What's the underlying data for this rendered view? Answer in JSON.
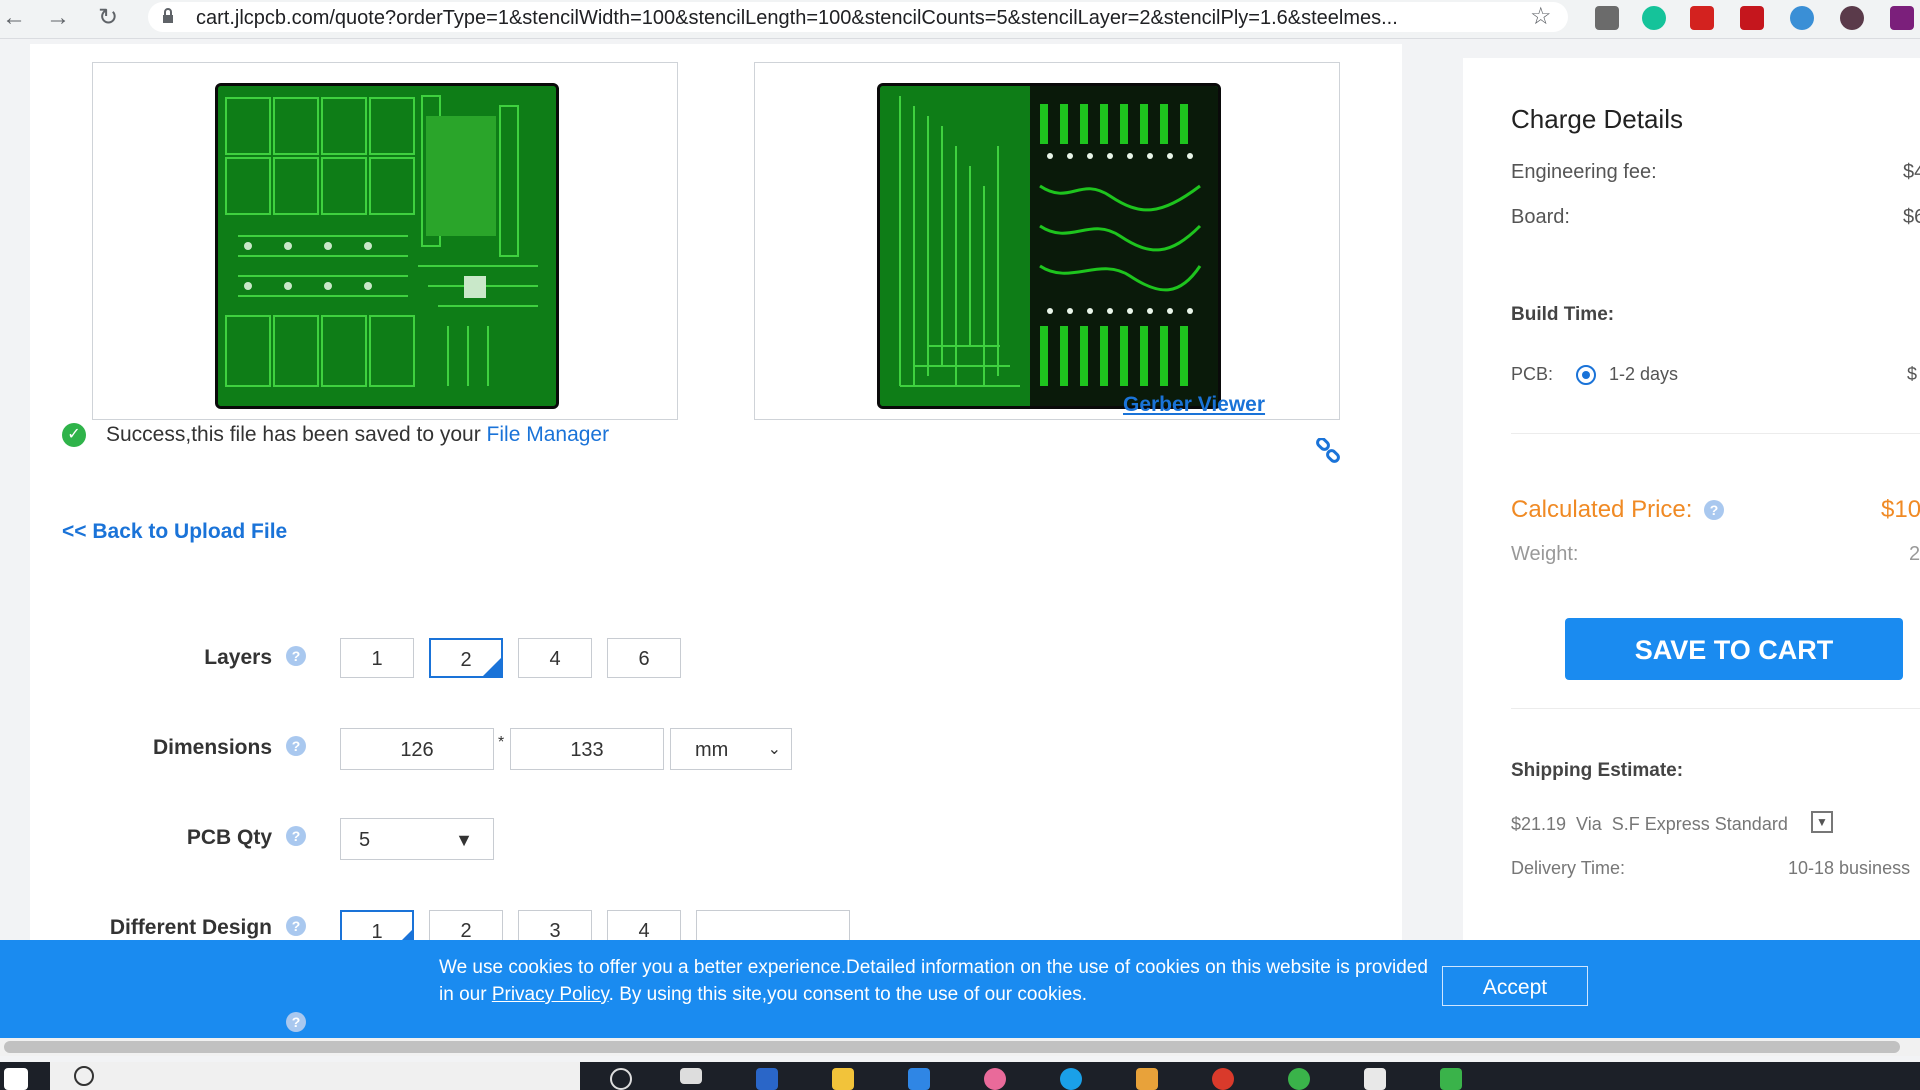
{
  "browser": {
    "url": "cart.jlcpcb.com/quote?orderType=1&stencilWidth=100&stencilLength=100&stencilCounts=5&stencilLayer=2&stencilPly=1.6&steelmes..."
  },
  "viewer": {
    "gerber_link": "Gerber Viewer"
  },
  "status": {
    "success_text": "Success,this file has been saved to your ",
    "file_manager_link": "File Manager",
    "back_link": "<< Back to Upload File"
  },
  "form": {
    "layers": {
      "label": "Layers",
      "options": [
        "1",
        "2",
        "4",
        "6"
      ],
      "selected": "2"
    },
    "dimensions": {
      "label": "Dimensions",
      "width": "126",
      "separator": "*",
      "length": "133",
      "unit": "mm"
    },
    "qty": {
      "label": "PCB Qty",
      "value": "5"
    },
    "design": {
      "label": "Different Design",
      "options": [
        "1",
        "2",
        "3",
        "4"
      ],
      "selected": "1"
    }
  },
  "charges": {
    "title": "Charge Details",
    "engineering_label": "Engineering fee:",
    "engineering_value": "$4",
    "board_label": "Board:",
    "board_value": "$6",
    "build_time_heading": "Build Time:",
    "pcb_label": "PCB:",
    "pcb_option": "1-2 days",
    "pcb_option_value": "$",
    "calc_label": "Calculated Price:",
    "calc_value": "$10",
    "weight_label": "Weight:",
    "weight_value": "2",
    "save_button": "SAVE TO CART",
    "shipping_heading": "Shipping Estimate:",
    "shipping_line": "$21.19  Via  S.F Express Standard",
    "delivery_label": "Delivery Time:",
    "delivery_value": "10-18 business"
  },
  "cookie": {
    "text_1": "We use cookies to offer you a better experience.Detailed information on the use of cookies on this website is provided in our ",
    "privacy_link": "Privacy Policy",
    "text_2": ". By using this site,you consent to the use of our cookies.",
    "accept": "Accept"
  },
  "colors": {
    "accent": "#1a8bf0",
    "link": "#1a73d8",
    "price": "#f08a24",
    "success": "#2fb34a",
    "pcb_green": "#0e7d17"
  }
}
